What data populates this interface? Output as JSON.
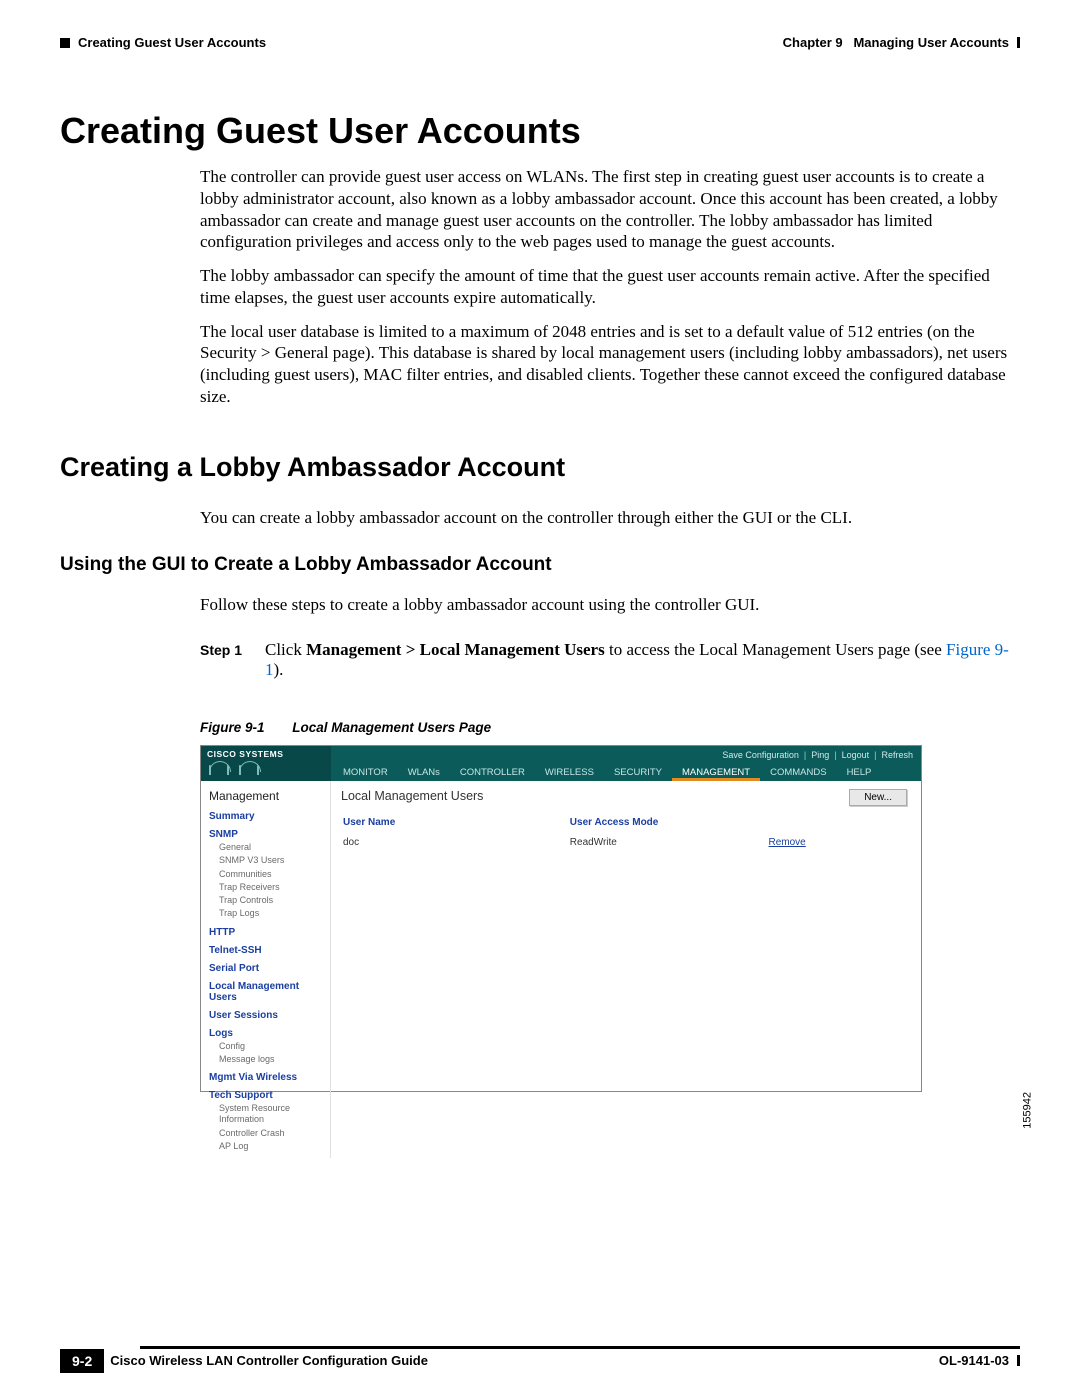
{
  "header": {
    "left_section": "Creating Guest User Accounts",
    "right_chapter": "Chapter 9",
    "right_title": "Managing User Accounts"
  },
  "headings": {
    "h1": "Creating Guest User Accounts",
    "h2": "Creating a Lobby Ambassador Account",
    "h3": "Using the GUI to Create a Lobby Ambassador Account"
  },
  "paragraphs": {
    "p1": "The controller can provide guest user access on WLANs. The first step in creating guest user accounts is to create a lobby administrator account, also known as a lobby ambassador account. Once this account has been created, a lobby ambassador can create and manage guest user accounts on the controller. The lobby ambassador has limited configuration privileges and access only to the web pages used to manage the guest accounts.",
    "p2": "The lobby ambassador can specify the amount of time that the guest user accounts remain active. After the specified time elapses, the guest user accounts expire automatically.",
    "p3": "The local user database is limited to a maximum of 2048 entries and is set to a default value of 512 entries (on the Security > General page). This database is shared by local management users (including lobby ambassadors), net users (including guest users), MAC filter entries, and disabled clients. Together these cannot exceed the configured database size.",
    "p4": "You can create a lobby ambassador account on the controller through either the GUI or the CLI.",
    "p5": "Follow these steps to create a lobby ambassador account using the controller GUI."
  },
  "step1": {
    "label": "Step 1",
    "pre": "Click ",
    "strong": "Management > Local Management Users",
    "mid": " to access the Local Management Users page (see ",
    "link": "Figure 9-1",
    "post": ")."
  },
  "figure": {
    "label": "Figure 9-1",
    "title": "Local Management Users Page",
    "ref_id": "155942"
  },
  "screenshot": {
    "logo": "CISCO SYSTEMS",
    "top_links": [
      "Save Configuration",
      "Ping",
      "Logout",
      "Refresh"
    ],
    "menus": [
      "MONITOR",
      "WLANs",
      "CONTROLLER",
      "WIRELESS",
      "SECURITY",
      "MANAGEMENT",
      "COMMANDS",
      "HELP"
    ],
    "active_menu_index": 5,
    "sidebar_title": "Management",
    "sidebar": [
      {
        "label": "Summary"
      },
      {
        "label": "SNMP",
        "subs": [
          "General",
          "SNMP V3 Users",
          "Communities",
          "Trap Receivers",
          "Trap Controls",
          "Trap Logs"
        ]
      },
      {
        "label": "HTTP"
      },
      {
        "label": "Telnet-SSH"
      },
      {
        "label": "Serial Port"
      },
      {
        "label": "Local Management Users"
      },
      {
        "label": "User Sessions"
      },
      {
        "label": "Logs",
        "subs": [
          "Config",
          "Message logs"
        ]
      },
      {
        "label": "Mgmt Via Wireless"
      },
      {
        "label": "Tech Support",
        "subs": [
          "System Resource Information",
          "Controller Crash",
          "AP Log"
        ]
      }
    ],
    "main_title": "Local Management Users",
    "new_button": "New...",
    "table": {
      "headers": [
        "User Name",
        "User Access Mode",
        ""
      ],
      "rows": [
        {
          "name": "doc",
          "mode": "ReadWrite",
          "action": "Remove"
        }
      ]
    }
  },
  "footer": {
    "page_num": "9-2",
    "book_title": "Cisco Wireless LAN Controller Configuration Guide",
    "doc_id": "OL-9141-03"
  }
}
